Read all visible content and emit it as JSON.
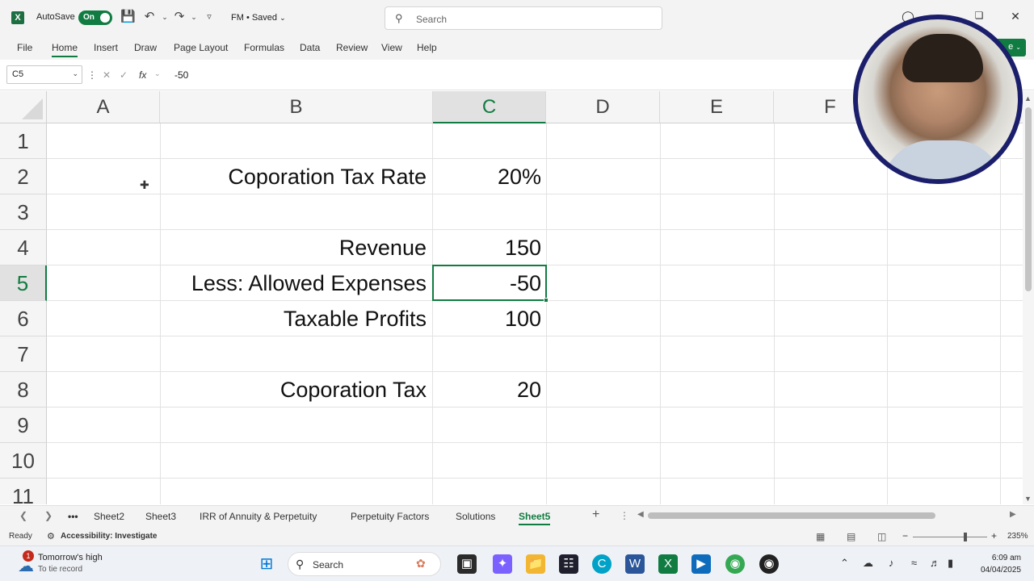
{
  "titlebar": {
    "app_logo": "X",
    "autosave_label": "AutoSave",
    "autosave_state": "On",
    "doc_title": "FM • Saved",
    "search_placeholder": "Search",
    "icons": [
      "excel-icon",
      "save-icon",
      "undo-icon",
      "redo-icon",
      "customize-icon",
      "search-icon",
      "profile-icon",
      "minimize-icon",
      "restore-icon",
      "close-icon"
    ]
  },
  "menu": {
    "items": [
      "File",
      "Home",
      "Insert",
      "Draw",
      "Page Layout",
      "Formulas",
      "Data",
      "Review",
      "View",
      "Help"
    ],
    "active": "Home",
    "share_label": "e"
  },
  "formula_bar": {
    "name_box": "C5",
    "fx": "fx",
    "value": "-50"
  },
  "grid": {
    "columns": [
      "A",
      "B",
      "C",
      "D",
      "E",
      "F"
    ],
    "rows": [
      "1",
      "2",
      "3",
      "4",
      "5",
      "6",
      "7",
      "8",
      "9",
      "10",
      "11"
    ],
    "selected_column": "C",
    "selected_row": "5",
    "cells": {
      "B2": "Coporation Tax Rate",
      "C2": "20%",
      "B4": "Revenue",
      "C4": "150",
      "B5": "Less: Allowed Expenses",
      "C5": "-50",
      "B6": "Taxable Profits",
      "C6": "100",
      "B8": "Coporation Tax",
      "C8": "20"
    }
  },
  "sheet_tabs": {
    "tabs": [
      "Sheet2",
      "Sheet3",
      "IRR of Annuity & Perpetuity",
      "Perpetuity Factors",
      "Solutions",
      "Sheet5"
    ],
    "active": "Sheet5",
    "more": "•••",
    "add": "+"
  },
  "status": {
    "ready": "Ready",
    "accessibility": "Accessibility: Investigate",
    "zoom": "235%"
  },
  "taskbar": {
    "weather_badge": "1",
    "weather_line1": "Tomorrow's high",
    "weather_line2": "To tie record",
    "search": "Search",
    "time": "6:09 am",
    "date": "04/04/2025"
  },
  "colors": {
    "excel_green": "#107c41",
    "webcam_ring": "#1b1f6b"
  }
}
